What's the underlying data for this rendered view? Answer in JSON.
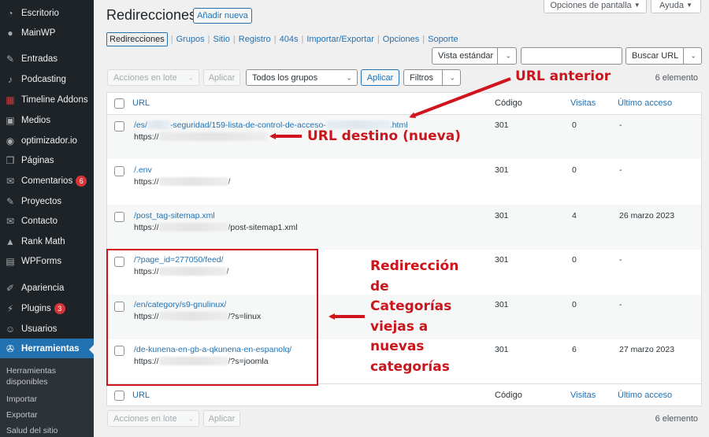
{
  "sidebar": {
    "items": [
      {
        "label": "Escritorio",
        "icon": "dashboard-icon"
      },
      {
        "label": "MainWP",
        "icon": "mainwp-icon"
      },
      {
        "label": "Entradas",
        "icon": "pin-icon"
      },
      {
        "label": "Podcasting",
        "icon": "microphone-icon"
      },
      {
        "label": "Timeline Addons",
        "icon": "timeline-icon"
      },
      {
        "label": "Medios",
        "icon": "media-icon"
      },
      {
        "label": "optimizador.io",
        "icon": "optimizer-icon"
      },
      {
        "label": "Páginas",
        "icon": "pages-icon"
      },
      {
        "label": "Comentarios",
        "icon": "comments-icon",
        "badge": "6"
      },
      {
        "label": "Proyectos",
        "icon": "pin-icon"
      },
      {
        "label": "Contacto",
        "icon": "mail-icon"
      },
      {
        "label": "Rank Math",
        "icon": "chart-icon"
      },
      {
        "label": "WPForms",
        "icon": "forms-icon"
      },
      {
        "label": "Apariencia",
        "icon": "brush-icon"
      },
      {
        "label": "Plugins",
        "icon": "plugin-icon",
        "badge": "3"
      },
      {
        "label": "Usuarios",
        "icon": "user-icon"
      },
      {
        "label": "Herramientas",
        "icon": "wrench-icon",
        "current": true
      }
    ],
    "submenu": [
      "Herramientas disponibles",
      "Importar",
      "Exportar",
      "Salud del sitio"
    ]
  },
  "header": {
    "screen_options": "Opciones de pantalla",
    "help": "Ayuda",
    "title": "Redirecciones",
    "add_new": "Añadir nueva"
  },
  "subnav": [
    "Redirecciones",
    "Grupos",
    "Sitio",
    "Registro",
    "404s",
    "Importar/Exportar",
    "Opciones",
    "Soporte"
  ],
  "search": {
    "view_select": "Vista estándar",
    "input_value": "",
    "button": "Buscar URL"
  },
  "filters": {
    "bulk_actions": "Acciones en lote",
    "apply": "Aplicar",
    "groups_select": "Todos los grupos",
    "apply_group": "Aplicar",
    "filters": "Filtros",
    "count": "6 elemento"
  },
  "table": {
    "columns": [
      "URL",
      "Código",
      "Visitas",
      "Último acceso"
    ],
    "rows": [
      {
        "src_pre": "/es/",
        "src_mid": "-seguridad/159-lista-de-control-de-acceso-",
        "src_post": ".html",
        "dst_pre": "https://",
        "dst_post": "",
        "code": "301",
        "hits": "0",
        "last": "-"
      },
      {
        "src_pre": "/.env",
        "src_mid": "",
        "src_post": "",
        "dst_pre": "https://",
        "dst_post": "/",
        "code": "301",
        "hits": "0",
        "last": "-"
      },
      {
        "src_pre": "/post_tag-sitemap.xml",
        "src_mid": "",
        "src_post": "",
        "dst_pre": "https://",
        "dst_post": "/post-sitemap1.xml",
        "code": "301",
        "hits": "4",
        "last": "26 marzo 2023"
      },
      {
        "src_pre": "/?page_id=277050/feed/",
        "src_mid": "",
        "src_post": "",
        "dst_pre": "https://",
        "dst_post": "/",
        "code": "301",
        "hits": "0",
        "last": "-"
      },
      {
        "src_pre": "/en/category/s9-gnulinux/",
        "src_mid": "",
        "src_post": "",
        "dst_pre": "https://",
        "dst_post": "/?s=linux",
        "code": "301",
        "hits": "0",
        "last": "-"
      },
      {
        "src_pre": "/de-kunena-en-gb-a-qkunena-en-espanolq/",
        "src_mid": "",
        "src_post": "",
        "dst_pre": "https://",
        "dst_post": "/?s=joomla",
        "code": "301",
        "hits": "6",
        "last": "27 marzo 2023"
      }
    ]
  },
  "footer": {
    "bulk_actions": "Acciones en lote",
    "apply": "Aplicar",
    "count": "6 elemento"
  },
  "annotations": {
    "old_url": "URL anterior",
    "new_url": "URL destino (nueva)",
    "categories": [
      "Redirección",
      "de",
      "Categorías",
      "viejas a",
      "nuevas",
      "categorías"
    ],
    "color": "#c9151b"
  }
}
